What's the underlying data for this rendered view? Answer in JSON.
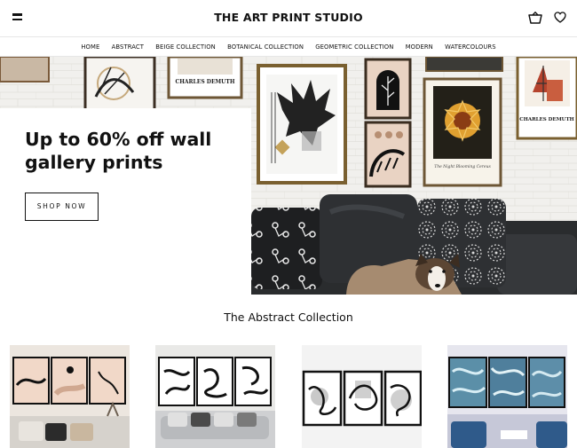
{
  "header": {
    "brand": "THE ART PRINT STUDIO",
    "menu_icon": "hamburger-menu-icon",
    "cart_icon": "shopping-basket-icon",
    "wishlist_icon": "heart-icon"
  },
  "nav": {
    "items": [
      "HOME",
      "ABSTRACT",
      "BEIGE COLLECTION",
      "BOTANICAL COLLECTION",
      "GEOMETRIC COLLECTION",
      "MODERN",
      "WATERCOLOURS"
    ]
  },
  "hero": {
    "title_line1": "Up to 60% off wall",
    "title_line2": "gallery prints",
    "button_label": "SHOP NOW",
    "poster_names": [
      "CHARLES DEMUTH",
      "CHARLES DEMUTH"
    ],
    "poster_caption": "The Night Blooming Cereus"
  },
  "collection": {
    "title": "The Abstract Collection",
    "products": [
      "beige-abstract-triptych",
      "black-white-line-triptych",
      "geometric-line-triptych",
      "blue-marble-triptych"
    ]
  },
  "colors": {
    "text": "#111111",
    "border": "#e6e6e6",
    "background": "#ffffff"
  }
}
